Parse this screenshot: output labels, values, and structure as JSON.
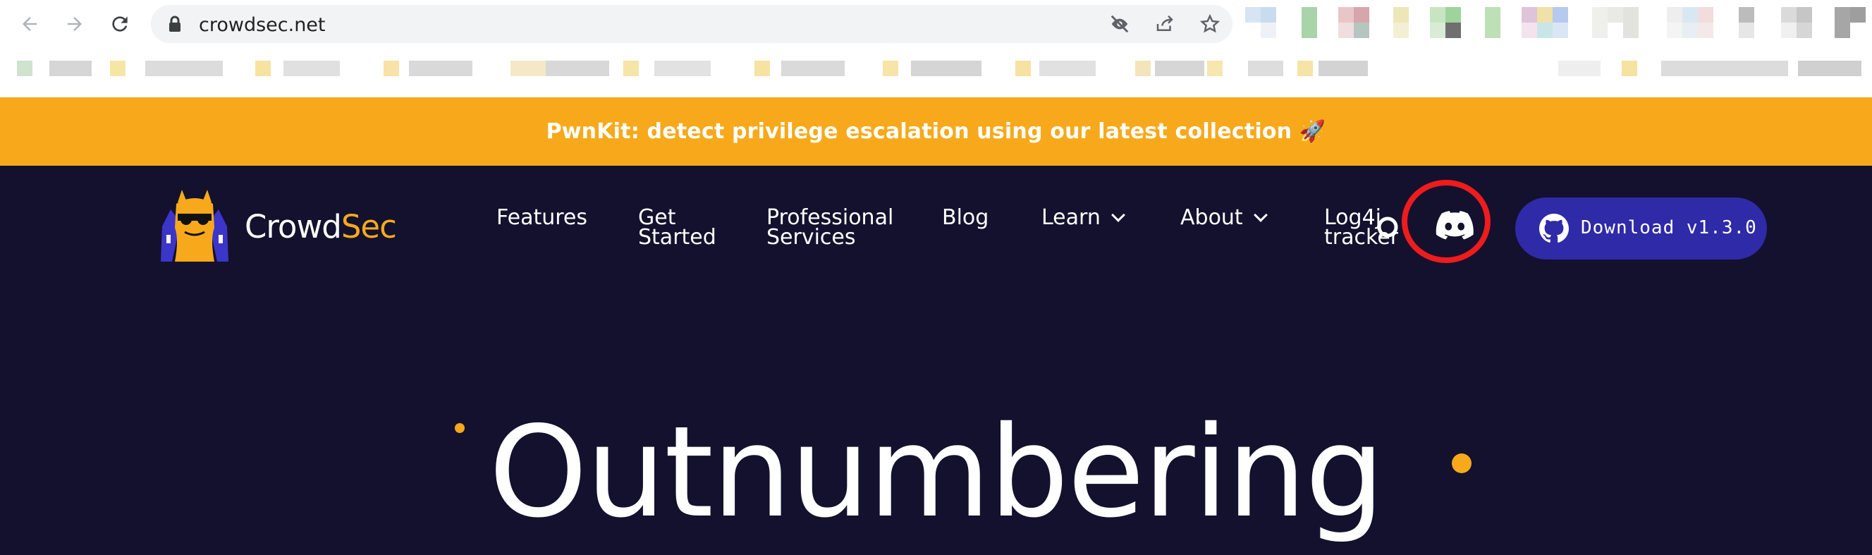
{
  "browser": {
    "url": "crowdsec.net",
    "back_icon": "arrow-left",
    "forward_icon": "arrow-right",
    "reload_icon": "reload",
    "lock_icon": "lock"
  },
  "banner": {
    "text": "PwnKit: detect privilege escalation using our latest collection 🚀"
  },
  "site": {
    "brand_first": "Crowd",
    "brand_second": "Sec",
    "nav": [
      {
        "label": "Features"
      },
      {
        "label": "Get Started"
      },
      {
        "label": "Professional Services"
      },
      {
        "label": "Blog"
      },
      {
        "label": "Learn"
      },
      {
        "label": "About"
      },
      {
        "label": "Log4j tracker"
      }
    ],
    "download_label": "Download v1.3.0",
    "hero_title": "Outnumbering"
  },
  "colors": {
    "accent": "#f7a91b",
    "background": "#13112e",
    "button": "#2f2aa8",
    "highlight": "#ee1c1c"
  }
}
